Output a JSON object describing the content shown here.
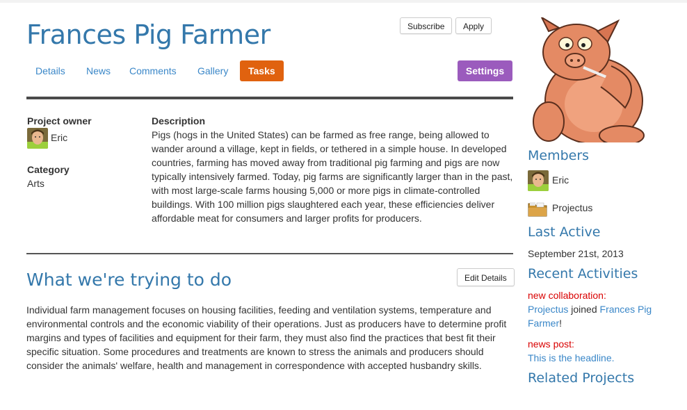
{
  "project": {
    "title": "Frances Pig Farmer"
  },
  "header_buttons": {
    "subscribe": "Subscribe",
    "apply": "Apply"
  },
  "tabs": [
    {
      "label": "Details"
    },
    {
      "label": "News"
    },
    {
      "label": "Comments"
    },
    {
      "label": "Gallery"
    },
    {
      "label": "Tasks",
      "active": true
    }
  ],
  "settings_label": "Settings",
  "owner": {
    "label": "Project owner",
    "name": "Eric"
  },
  "category": {
    "label": "Category",
    "value": "Arts"
  },
  "description": {
    "label": "Description",
    "text": "Pigs (hogs in the United States) can be farmed as free range, being allowed to wander around a village, kept in fields, or tethered in a simple house. In developed countries, farming has moved away from traditional pig farming and pigs are now typically intensively farmed. Today, pig farms are significantly larger than in the past, with most large-scale farms housing 5,000 or more pigs in climate-controlled buildings. With 100 million pigs slaughtered each year, these efficiencies deliver affordable meat for consumers and larger profits for producers."
  },
  "goals": {
    "heading": "What we're trying to do",
    "edit_label": "Edit Details",
    "text": "Individual farm management focuses on housing facilities, feeding and ventilation systems, temperature and environmental controls and the economic viability of their operations. Just as producers have to determine profit margins and types of facilities and equipment for their farm, they must also find the practices that best fit their specific situation. Some procedures and treatments are known to stress the animals and producers should consider the animals' welfare, health and management in correspondence with accepted husbandry skills."
  },
  "sidebar": {
    "members_heading": "Members",
    "members": [
      {
        "name": "Eric",
        "icon": "person-avatar"
      },
      {
        "name": "Projectus",
        "icon": "folder-icon"
      }
    ],
    "last_active_heading": "Last Active",
    "last_active_date": "September 21st, 2013",
    "recent_heading": "Recent Activities",
    "activities": [
      {
        "type": "new collaboration:",
        "actor": "Projectus",
        "verb": "joined",
        "target": "Frances Pig Farmer",
        "suffix": "!"
      },
      {
        "type": "news post:",
        "link": "This is the headline."
      }
    ],
    "related_heading": "Related Projects"
  },
  "colors": {
    "link": "#3a87c8",
    "heading": "#3478ab",
    "tasks_tab": "#e0620f",
    "settings": "#9b5bbd",
    "activity_type": "#d90000"
  }
}
